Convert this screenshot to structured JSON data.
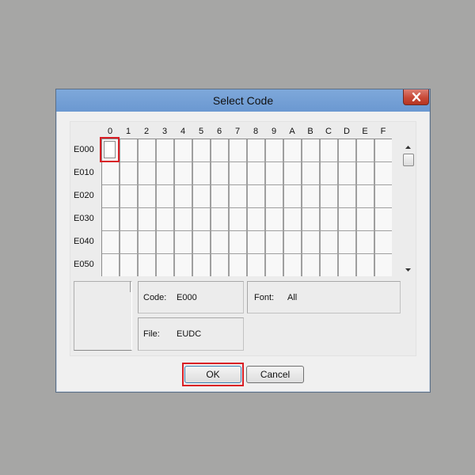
{
  "dialog": {
    "title": "Select Code",
    "columns": [
      "0",
      "1",
      "2",
      "3",
      "4",
      "5",
      "6",
      "7",
      "8",
      "9",
      "A",
      "B",
      "C",
      "D",
      "E",
      "F"
    ],
    "rows": [
      "E000",
      "E010",
      "E020",
      "E030",
      "E040",
      "E050"
    ],
    "selected_cell": {
      "row": "E000",
      "column": "0"
    },
    "info": {
      "code_label": "Code:",
      "code_value": "E000",
      "font_label": "Font:",
      "font_value": "All",
      "file_label": "File:",
      "file_value": "EUDC"
    },
    "buttons": {
      "ok": "OK",
      "cancel": "Cancel"
    }
  },
  "colors": {
    "highlight": "#d91f26",
    "titlebar": "#6b98d1",
    "close_button": "#c84937",
    "background": "#a6a6a5"
  },
  "icons": {
    "close": "close-icon",
    "scroll_up": "scroll-up-arrow-icon",
    "scroll_down": "scroll-down-arrow-icon"
  }
}
